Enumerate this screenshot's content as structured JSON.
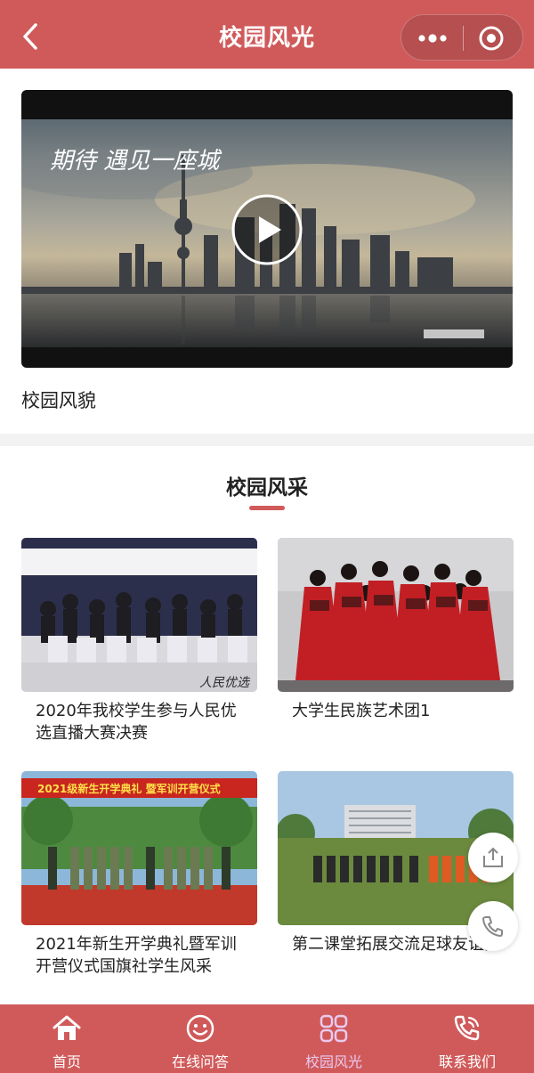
{
  "header": {
    "title": "校园风光",
    "back_icon": "chevron-left-icon",
    "more_icon": "more-dots-icon",
    "close_icon": "target-close-icon"
  },
  "video": {
    "overlay_title": "期待 遇见一座城",
    "play_icon": "play-icon",
    "caption": "校园风貌"
  },
  "section": {
    "title": "校园风采"
  },
  "cards": [
    {
      "title": "2020年我校学生参与人民优选直播大赛决赛",
      "image_watermark": "人民优选"
    },
    {
      "title": "大学生民族艺术团1"
    },
    {
      "title": "2021年新生开学典礼暨军训开营仪式国旗社学生风采",
      "image_banner": "2021级新生开学典礼 暨军训开营仪式"
    },
    {
      "title": "第二课堂拓展交流足球友谊赛"
    }
  ],
  "floating": {
    "share_icon": "share-upload-icon",
    "phone_icon": "phone-icon"
  },
  "tabbar": {
    "items": [
      {
        "label": "首页",
        "icon": "home-icon",
        "active": false
      },
      {
        "label": "在线问答",
        "icon": "smile-icon",
        "active": false
      },
      {
        "label": "校园风光",
        "icon": "grid-icon",
        "active": true
      },
      {
        "label": "联系我们",
        "icon": "phone-call-icon",
        "active": false
      }
    ]
  },
  "colors": {
    "brand": "#d05a5a",
    "active_tab": "#e9c9f0"
  }
}
